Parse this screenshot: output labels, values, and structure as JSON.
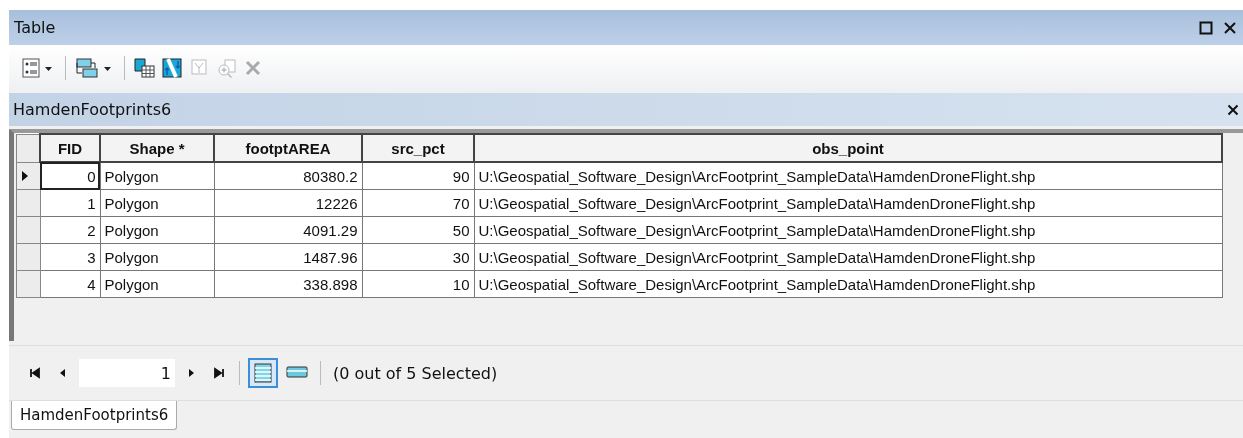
{
  "window": {
    "title": "Table"
  },
  "layer": {
    "title": "HamdenFootprints6"
  },
  "table": {
    "columns": [
      "FID",
      "Shape *",
      "footptAREA",
      "src_pct",
      "obs_point"
    ],
    "rows": [
      {
        "current": true,
        "cells": [
          "0",
          "Polygon",
          "80380.2",
          "90",
          "U:\\Geospatial_Software_Design\\ArcFootprint_SampleData\\HamdenDroneFlight.shp"
        ]
      },
      {
        "current": false,
        "cells": [
          "1",
          "Polygon",
          "12226",
          "70",
          "U:\\Geospatial_Software_Design\\ArcFootprint_SampleData\\HamdenDroneFlight.shp"
        ]
      },
      {
        "current": false,
        "cells": [
          "2",
          "Polygon",
          "4091.29",
          "50",
          "U:\\Geospatial_Software_Design\\ArcFootprint_SampleData\\HamdenDroneFlight.shp"
        ]
      },
      {
        "current": false,
        "cells": [
          "3",
          "Polygon",
          "1487.96",
          "30",
          "U:\\Geospatial_Software_Design\\ArcFootprint_SampleData\\HamdenDroneFlight.shp"
        ]
      },
      {
        "current": false,
        "cells": [
          "4",
          "Polygon",
          "338.898",
          "10",
          "U:\\Geospatial_Software_Design\\ArcFootprint_SampleData\\HamdenDroneFlight.shp"
        ]
      }
    ]
  },
  "navigator": {
    "record": "1",
    "views": [
      {
        "kind": "all",
        "selected": true
      },
      {
        "kind": "selected",
        "selected": false
      }
    ],
    "status": "(0 out of 5 Selected)"
  },
  "tabs": [
    {
      "label": "HamdenFootprints6",
      "selected": true
    }
  ]
}
